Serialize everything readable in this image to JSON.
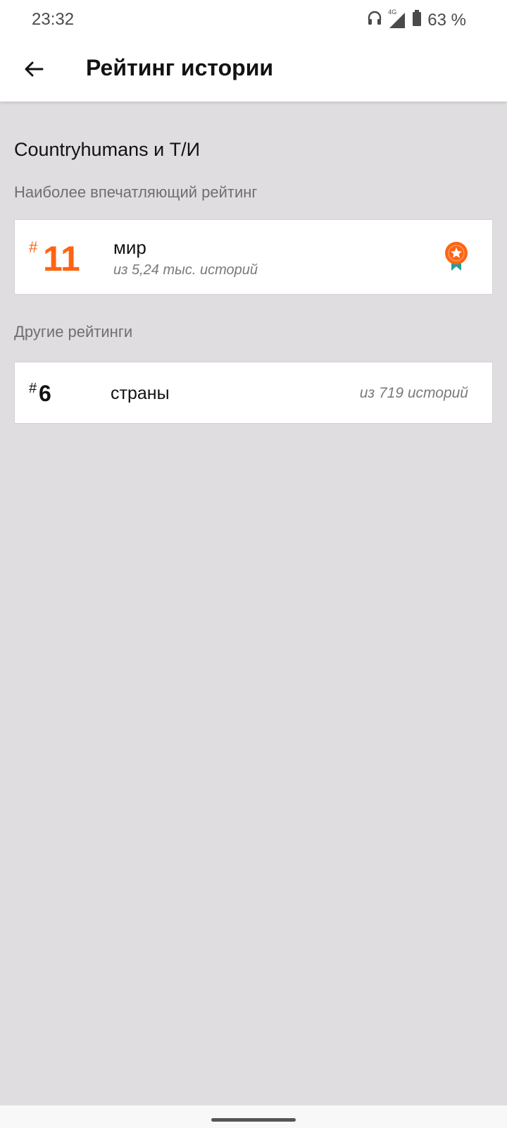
{
  "status_bar": {
    "time": "23:32",
    "network_label": "4G",
    "battery_text": "63 %",
    "icons": [
      "headphones-icon",
      "signal-icon",
      "battery-icon"
    ]
  },
  "app_bar": {
    "title": "Рейтинг истории",
    "back_icon": "arrow-left-icon"
  },
  "story": {
    "title": "Countryhumans и Т/И"
  },
  "sections": {
    "main_label": "Наиболее впечатляющий рейтинг",
    "other_label": "Другие рейтинги"
  },
  "main_ranking": {
    "hash": "#",
    "rank": "11",
    "name": "мир",
    "subtitle": "из 5,24 тыс. историй",
    "badge_icon": "award-ribbon-icon"
  },
  "other_rankings": [
    {
      "hash": "#",
      "rank": "6",
      "name": "страны",
      "subtitle": "из 719 историй"
    }
  ],
  "colors": {
    "accent": "#ff6413",
    "ribbon": "#1fa09a",
    "background": "#dfdde0"
  }
}
